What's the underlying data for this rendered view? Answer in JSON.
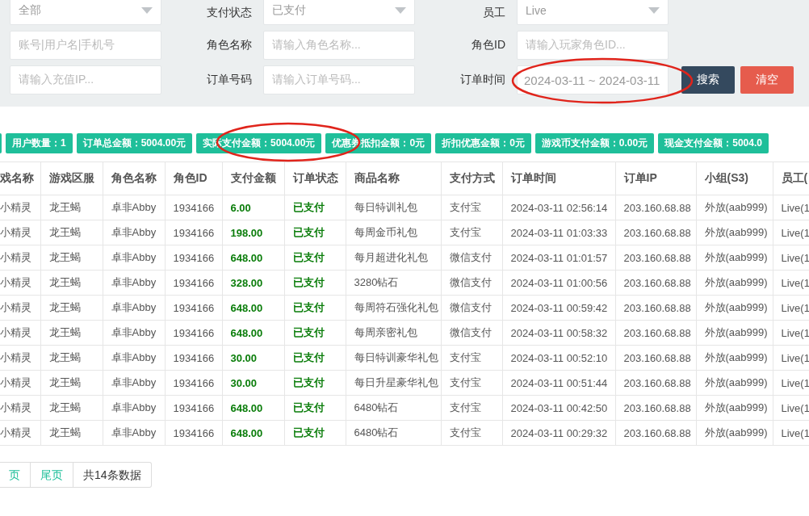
{
  "filters": [
    {
      "kind": "select",
      "value": "全部"
    },
    {
      "label": "支付状态",
      "kind": "select",
      "value": "已支付"
    },
    {
      "label": "员工",
      "kind": "select",
      "value": "Live"
    },
    {
      "kind": "input",
      "placeholder": "账号|用户名|手机号"
    },
    {
      "label": "角色名称",
      "kind": "input",
      "placeholder": "请输入角色名称..."
    },
    {
      "label": "角色ID",
      "kind": "input",
      "placeholder": "请输入玩家角色ID..."
    },
    {
      "kind": "input",
      "placeholder": "请输入充值IP..."
    },
    {
      "label": "订单号码",
      "kind": "input",
      "placeholder": "请输入订单号码..."
    },
    {
      "label": "订单时间",
      "kind": "date",
      "value": "2024-03-11 ~ 2024-03-11"
    }
  ],
  "buttons": [
    {
      "label": "搜索",
      "kind": "primary"
    },
    {
      "label": "清空",
      "kind": "danger"
    }
  ],
  "stats": [
    "用户数量：1",
    "订单总金额：5004.00元",
    "实际支付金额：5004.00元",
    "优惠券抵扣金额：0元",
    "折扣优惠金额：0元",
    "游戏币支付金额：0.00元",
    "现金支付金额：5004.0"
  ],
  "table": {
    "columns": [
      {
        "label": "戏名称",
        "kind": "text"
      },
      {
        "label": "游戏区服",
        "kind": "text"
      },
      {
        "label": "角色名称",
        "kind": "text"
      },
      {
        "label": "角色ID",
        "kind": "text"
      },
      {
        "label": "支付金额",
        "kind": "amount"
      },
      {
        "label": "订单状态",
        "kind": "status"
      },
      {
        "label": "商品名称",
        "kind": "text"
      },
      {
        "label": "支付方式",
        "kind": "text"
      },
      {
        "label": "订单时间",
        "kind": "text"
      },
      {
        "label": "订单IP",
        "kind": "text"
      },
      {
        "label": "小组(S3)",
        "kind": "text"
      },
      {
        "label": "员工(",
        "kind": "text"
      }
    ],
    "rows": [
      [
        "小精灵",
        "龙王蝎",
        "卓非Abby",
        "1934166",
        "6.00",
        "已支付",
        "每日特训礼包",
        "支付宝",
        "2024-03-11 02:56:14",
        "203.160.68.88",
        "外放(aab999)",
        "Live(1"
      ],
      [
        "小精灵",
        "龙王蝎",
        "卓非Abby",
        "1934166",
        "198.00",
        "已支付",
        "每周金币礼包",
        "支付宝",
        "2024-03-11 01:03:33",
        "203.160.68.88",
        "外放(aab999)",
        "Live(1"
      ],
      [
        "小精灵",
        "龙王蝎",
        "卓非Abby",
        "1934166",
        "648.00",
        "已支付",
        "每月超进化礼包",
        "微信支付",
        "2024-03-11 01:01:57",
        "203.160.68.88",
        "外放(aab999)",
        "Live(1"
      ],
      [
        "小精灵",
        "龙王蝎",
        "卓非Abby",
        "1934166",
        "328.00",
        "已支付",
        "3280钻石",
        "微信支付",
        "2024-03-11 01:00:56",
        "203.160.68.88",
        "外放(aab999)",
        "Live(1"
      ],
      [
        "小精灵",
        "龙王蝎",
        "卓非Abby",
        "1934166",
        "648.00",
        "已支付",
        "每周符石强化礼包",
        "微信支付",
        "2024-03-11 00:59:42",
        "203.160.68.88",
        "外放(aab999)",
        "Live(1"
      ],
      [
        "小精灵",
        "龙王蝎",
        "卓非Abby",
        "1934166",
        "648.00",
        "已支付",
        "每周亲密礼包",
        "微信支付",
        "2024-03-11 00:58:32",
        "203.160.68.88",
        "外放(aab999)",
        "Live(1"
      ],
      [
        "小精灵",
        "龙王蝎",
        "卓非Abby",
        "1934166",
        "30.00",
        "已支付",
        "每日特训豪华礼包",
        "支付宝",
        "2024-03-11 00:52:10",
        "203.160.68.88",
        "外放(aab999)",
        "Live(1"
      ],
      [
        "小精灵",
        "龙王蝎",
        "卓非Abby",
        "1934166",
        "30.00",
        "已支付",
        "每日升星豪华礼包",
        "支付宝",
        "2024-03-11 00:51:44",
        "203.160.68.88",
        "外放(aab999)",
        "Live(1"
      ],
      [
        "小精灵",
        "龙王蝎",
        "卓非Abby",
        "1934166",
        "648.00",
        "已支付",
        "6480钻石",
        "支付宝",
        "2024-03-11 00:42:50",
        "203.160.68.88",
        "外放(aab999)",
        "Live(1"
      ],
      [
        "小精灵",
        "龙王蝎",
        "卓非Abby",
        "1934166",
        "648.00",
        "已支付",
        "6480钻石",
        "支付宝",
        "2024-03-11 00:29:32",
        "203.160.68.88",
        "外放(aab999)",
        "Live(1"
      ]
    ]
  },
  "pager": [
    {
      "label": "页",
      "kind": "link"
    },
    {
      "label": "尾页",
      "kind": "link"
    },
    {
      "label": "共14条数据",
      "kind": "info"
    }
  ]
}
